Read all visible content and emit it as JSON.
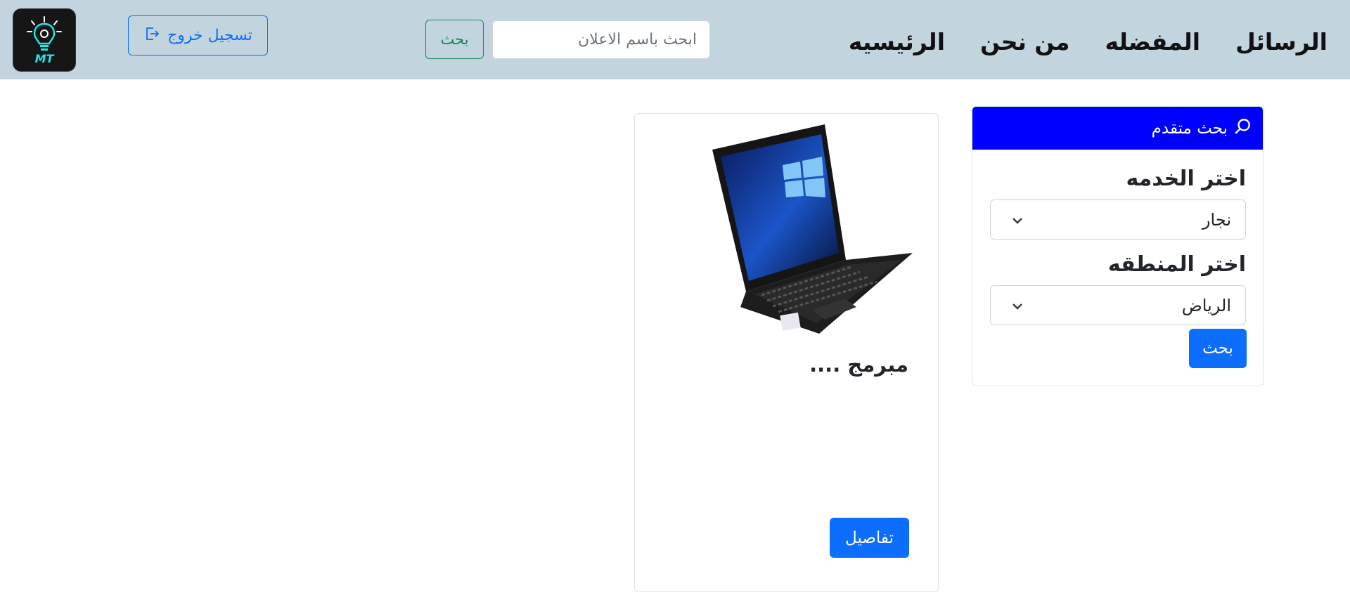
{
  "nav": {
    "links": [
      "الرسائل",
      "المفضله",
      "من نحن",
      "الرئيسيه"
    ],
    "search_placeholder": "ابحث باسم الاعلان",
    "search_button": "بحث",
    "logout_label": "تسجيل  خروج",
    "logo_text": "MT"
  },
  "advanced_search": {
    "header": "بحث متقدم",
    "service_label": "اختر الخدمه",
    "service_value": "نجار",
    "region_label": "اختر المنطقه",
    "region_value": "الرياض",
    "submit_label": "بحث"
  },
  "listing": {
    "title": "مبرمج ....",
    "details_label": "تفاصيل"
  },
  "colors": {
    "navbar_bg": "#c2d4de",
    "accent_blue": "#0d6efd",
    "search_header": "#0000ff",
    "success_green": "#198754"
  }
}
